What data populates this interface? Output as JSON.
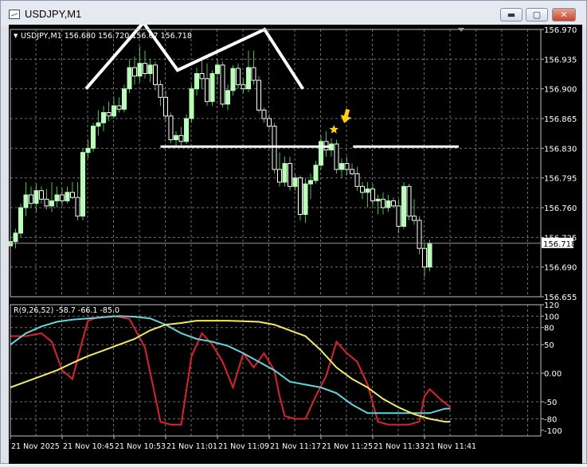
{
  "window": {
    "title": "USDJPY,M1",
    "buttons": {
      "minimize": "▬",
      "maximize": "▢",
      "close": "✕"
    }
  },
  "colors": {
    "background": "#000000",
    "grid": "#6e6e6e",
    "axis_text": "#ffffff",
    "bull_candle": "#b8ffb8",
    "bear_candle": "#ffffff",
    "wick": "#3fbf3f",
    "pattern_lines": "#ffffff",
    "marker": "#ffd400",
    "rsi_red": "#e0202a",
    "rsi_cyan": "#5fd6de",
    "rsi_yellow": "#f2ec5a",
    "current_price_box": "#ffffff"
  },
  "chart_data": [
    {
      "type": "candlestick",
      "title": "USDJPY,M1",
      "ohlc_header": "USDJPY,M1  156.680 156.720 156.67 156.718",
      "ylim": [
        156.655,
        156.97
      ],
      "y_ticks": [
        "156.970",
        "156.935",
        "156.900",
        "156.865",
        "156.830",
        "156.795",
        "156.760",
        "156.725",
        "156.690",
        "156.655"
      ],
      "current_price": "156.718",
      "x_ticks": [
        "21 Nov 2025",
        "21 Nov 10:45",
        "21 Nov 10:53",
        "21 Nov 11:01",
        "21 Nov 11:09",
        "21 Nov 11:17",
        "21 Nov 11:25",
        "21 Nov 11:33",
        "21 Nov 11:41"
      ],
      "grid": true,
      "candles": [
        [
          156.715,
          156.73,
          156.67,
          156.72
        ],
        [
          156.72,
          156.735,
          156.712,
          156.73
        ],
        [
          156.73,
          156.765,
          156.725,
          156.76
        ],
        [
          156.76,
          156.79,
          156.75,
          156.775
        ],
        [
          156.775,
          156.785,
          156.76,
          156.765
        ],
        [
          156.765,
          156.788,
          156.755,
          156.78
        ],
        [
          156.78,
          156.785,
          156.765,
          156.77
        ],
        [
          156.77,
          156.782,
          156.758,
          156.762
        ],
        [
          156.762,
          156.79,
          156.755,
          156.768
        ],
        [
          156.768,
          156.785,
          156.76,
          156.775
        ],
        [
          156.775,
          156.783,
          156.762,
          156.768
        ],
        [
          156.768,
          156.785,
          156.765,
          156.778
        ],
        [
          156.778,
          156.79,
          156.77,
          156.772
        ],
        [
          156.772,
          156.79,
          156.745,
          156.75
        ],
        [
          156.75,
          156.83,
          156.745,
          156.825
        ],
        [
          156.825,
          156.84,
          156.818,
          156.83
        ],
        [
          156.83,
          156.86,
          156.826,
          156.856
        ],
        [
          156.856,
          156.875,
          156.845,
          156.86
        ],
        [
          156.86,
          156.88,
          156.85,
          156.872
        ],
        [
          156.872,
          156.885,
          156.862,
          156.868
        ],
        [
          156.868,
          156.89,
          156.865,
          156.88
        ],
        [
          156.88,
          156.89,
          156.872,
          156.876
        ],
        [
          156.876,
          156.905,
          156.872,
          156.9
        ],
        [
          156.9,
          156.935,
          156.895,
          156.925
        ],
        [
          156.925,
          156.938,
          156.905,
          156.915
        ],
        [
          156.915,
          156.95,
          156.908,
          156.93
        ],
        [
          156.93,
          156.945,
          156.912,
          156.918
        ],
        [
          156.918,
          156.935,
          156.908,
          156.928
        ],
        [
          156.928,
          156.932,
          156.898,
          156.905
        ],
        [
          156.905,
          156.91,
          156.88,
          156.89
        ],
        [
          156.89,
          156.898,
          156.862,
          156.868
        ],
        [
          156.868,
          156.872,
          156.836,
          156.84
        ],
        [
          156.84,
          156.85,
          156.832,
          156.845
        ],
        [
          156.845,
          156.855,
          156.832,
          156.838
        ],
        [
          156.838,
          156.87,
          156.835,
          156.865
        ],
        [
          156.865,
          156.905,
          156.86,
          156.9
        ],
        [
          156.9,
          156.925,
          156.892,
          156.918
        ],
        [
          156.918,
          156.935,
          156.9,
          156.912
        ],
        [
          156.912,
          156.93,
          156.88,
          156.885
        ],
        [
          156.885,
          156.922,
          156.88,
          156.918
        ],
        [
          156.918,
          156.935,
          156.905,
          156.928
        ],
        [
          156.928,
          156.932,
          156.878,
          156.882
        ],
        [
          156.882,
          156.905,
          156.875,
          156.898
        ],
        [
          156.898,
          156.928,
          156.892,
          156.924
        ],
        [
          156.924,
          156.93,
          156.9,
          156.905
        ],
        [
          156.905,
          156.912,
          156.895,
          156.9
        ],
        [
          156.9,
          156.945,
          156.896,
          156.925
        ],
        [
          156.925,
          156.945,
          156.905,
          156.91
        ],
        [
          156.91,
          156.915,
          156.872,
          156.875
        ],
        [
          156.875,
          156.878,
          156.86,
          156.865
        ],
        [
          156.865,
          156.87,
          156.852,
          156.856
        ],
        [
          156.856,
          156.86,
          156.8,
          156.805
        ],
        [
          156.805,
          156.825,
          156.785,
          156.79
        ],
        [
          156.79,
          156.82,
          156.785,
          156.812
        ],
        [
          156.812,
          156.82,
          156.78,
          156.785
        ],
        [
          156.785,
          156.8,
          156.78,
          156.795
        ],
        [
          156.795,
          156.798,
          156.745,
          156.752
        ],
        [
          156.752,
          156.795,
          156.742,
          156.788
        ],
        [
          156.788,
          156.8,
          156.77,
          156.792
        ],
        [
          156.792,
          156.815,
          156.788,
          156.81
        ],
        [
          156.81,
          156.845,
          156.805,
          156.838
        ],
        [
          156.838,
          156.85,
          156.82,
          156.828
        ],
        [
          156.828,
          156.842,
          156.82,
          156.835
        ],
        [
          156.835,
          156.84,
          156.8,
          156.805
        ],
        [
          156.805,
          156.818,
          156.795,
          156.812
        ],
        [
          156.812,
          156.82,
          156.798,
          156.805
        ],
        [
          156.805,
          156.812,
          156.798,
          156.8
        ],
        [
          156.8,
          156.808,
          156.78,
          156.785
        ],
        [
          156.785,
          156.79,
          156.77,
          156.778
        ],
        [
          156.778,
          156.79,
          156.76,
          156.782
        ],
        [
          156.782,
          156.788,
          156.762,
          156.768
        ],
        [
          156.768,
          156.775,
          156.752,
          156.77
        ],
        [
          156.77,
          156.778,
          156.752,
          156.76
        ],
        [
          156.76,
          156.775,
          156.755,
          156.768
        ],
        [
          156.768,
          156.772,
          156.76,
          156.762
        ],
        [
          156.762,
          156.77,
          156.73,
          156.738
        ],
        [
          156.738,
          156.79,
          156.735,
          156.785
        ],
        [
          156.785,
          156.788,
          156.745,
          156.75
        ],
        [
          156.75,
          156.77,
          156.74,
          156.745
        ],
        [
          156.745,
          156.75,
          156.705,
          156.712
        ],
        [
          156.712,
          156.718,
          156.678,
          156.69
        ],
        [
          156.69,
          156.722,
          156.685,
          156.718
        ]
      ],
      "annotations": {
        "head_shoulders": [
          [
            14.6,
            156.9
          ],
          [
            25.7,
            156.978
          ],
          [
            32.3,
            156.922
          ],
          [
            49.1,
            156.97
          ],
          [
            56.5,
            156.9
          ]
        ],
        "neckline_left": {
          "x": [
            29.0,
            61.8
          ],
          "y": 156.832
        },
        "neckline_right": {
          "x": [
            66.2,
            86.6
          ],
          "y": 156.832
        },
        "star_marker": {
          "x": 62.5,
          "y": 156.852
        },
        "arrow_marker": {
          "x": 64.7,
          "y": 156.865
        }
      }
    },
    {
      "type": "line",
      "title": "R(9,26,52) -58.7 -66.1 -85.0",
      "ylim": [
        -110,
        120
      ],
      "y_ticks": [
        "120",
        "100",
        "80",
        "50",
        "0.00",
        "-50",
        "-80",
        "-100"
      ],
      "grid": true,
      "series": [
        {
          "name": "",
          "color": "#e0202a",
          "x": [
            0,
            3,
            6,
            8,
            10,
            12,
            14,
            15,
            17,
            20,
            23,
            26,
            29,
            31,
            33,
            35,
            37,
            39,
            41,
            43,
            45,
            47,
            49,
            51,
            52,
            53,
            55,
            57,
            59,
            61,
            63,
            65,
            67,
            69,
            71,
            73,
            75,
            77,
            79,
            80,
            81,
            83,
            85
          ],
          "y": [
            65,
            65,
            70,
            55,
            5,
            -10,
            60,
            92,
            98,
            100,
            95,
            45,
            -85,
            -90,
            -90,
            30,
            70,
            50,
            20,
            -25,
            35,
            10,
            35,
            5,
            -40,
            -75,
            -80,
            -80,
            -40,
            -5,
            55,
            35,
            20,
            -20,
            -85,
            -90,
            -90,
            -90,
            -85,
            -40,
            -28,
            -45,
            -60
          ]
        },
        {
          "name": "",
          "color": "#5fd6de",
          "x": [
            0,
            3,
            6,
            9,
            12,
            15,
            18,
            21,
            24,
            27,
            30,
            33,
            36,
            39,
            42,
            45,
            48,
            51,
            54,
            57,
            60,
            63,
            66,
            69,
            72,
            75,
            78,
            81,
            84,
            85
          ],
          "y": [
            50,
            70,
            82,
            90,
            94,
            96,
            98,
            100,
            99,
            96,
            85,
            70,
            60,
            55,
            48,
            35,
            20,
            5,
            -15,
            -20,
            -25,
            -35,
            -55,
            -70,
            -70,
            -70,
            -70,
            -70,
            -62,
            -62
          ]
        },
        {
          "name": "",
          "color": "#f2ec5a",
          "x": [
            0,
            3,
            6,
            9,
            12,
            15,
            18,
            21,
            24,
            27,
            30,
            33,
            36,
            39,
            42,
            45,
            48,
            51,
            54,
            57,
            60,
            63,
            66,
            69,
            72,
            75,
            78,
            81,
            84,
            85
          ],
          "y": [
            -25,
            -15,
            -5,
            5,
            18,
            30,
            40,
            50,
            60,
            75,
            85,
            88,
            92,
            92,
            92,
            91,
            90,
            85,
            75,
            65,
            40,
            10,
            -10,
            -25,
            -45,
            -60,
            -72,
            -80,
            -85,
            -85
          ]
        }
      ]
    }
  ]
}
